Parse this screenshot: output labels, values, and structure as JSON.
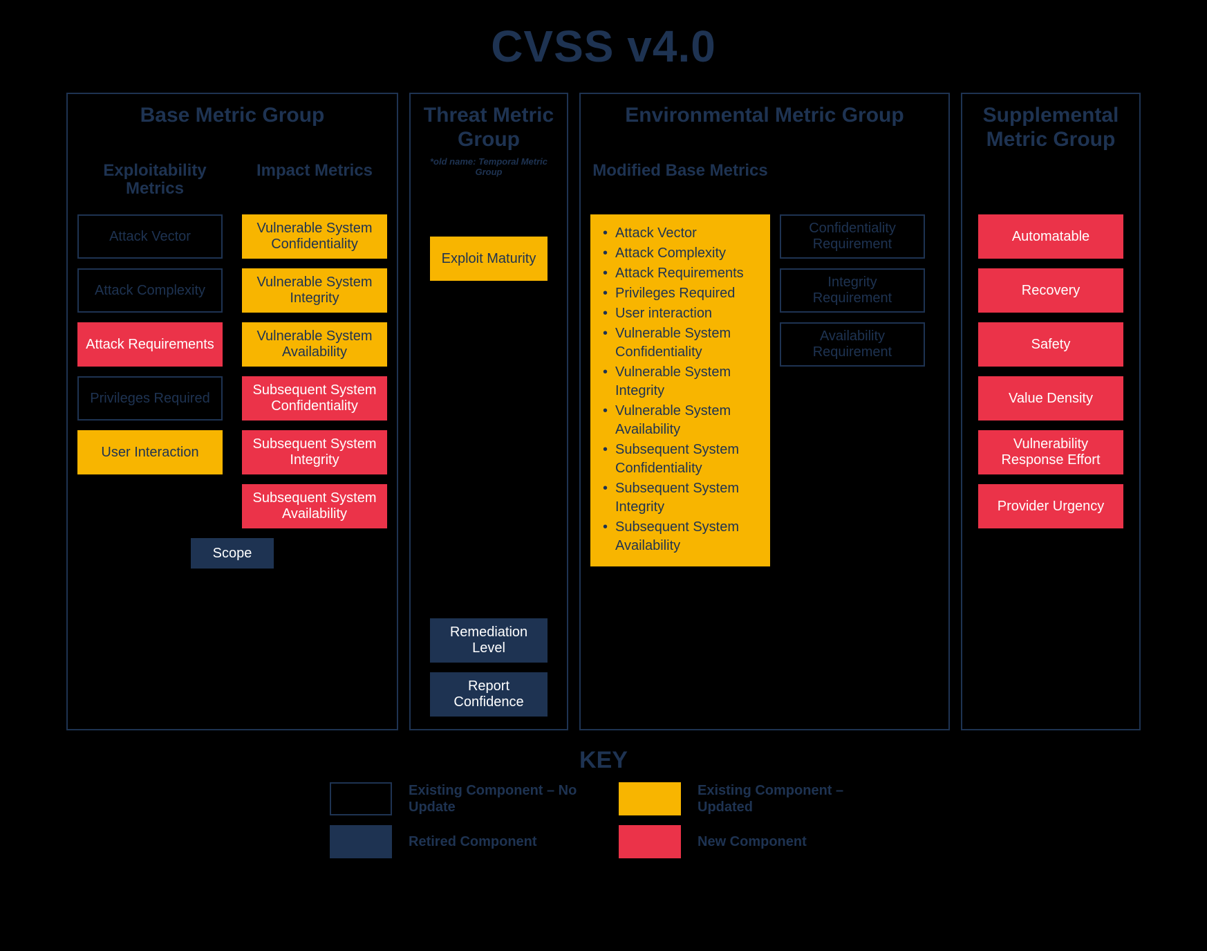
{
  "title": "CVSS v4.0",
  "groups": {
    "base": {
      "title": "Base Metric Group",
      "exploitability": {
        "title": "Exploitability Metrics",
        "items": [
          {
            "label": "Attack Vector",
            "kind": "existing"
          },
          {
            "label": "Attack Complexity",
            "kind": "existing"
          },
          {
            "label": "Attack Requirements",
            "kind": "new"
          },
          {
            "label": "Privileges Required",
            "kind": "existing"
          },
          {
            "label": "User Interaction",
            "kind": "updated"
          }
        ]
      },
      "impact": {
        "title": "Impact Metrics",
        "items": [
          {
            "label": "Vulnerable System Confidentiality",
            "kind": "updated"
          },
          {
            "label": "Vulnerable System Integrity",
            "kind": "updated"
          },
          {
            "label": "Vulnerable System Availability",
            "kind": "updated"
          },
          {
            "label": "Subsequent System Confidentiality",
            "kind": "new"
          },
          {
            "label": "Subsequent System Integrity",
            "kind": "new"
          },
          {
            "label": "Subsequent System Availability",
            "kind": "new"
          }
        ]
      },
      "scope": {
        "label": "Scope",
        "kind": "retired"
      }
    },
    "threat": {
      "title": "Threat Metric Group",
      "note": "*old name: Temporal Metric Group",
      "items_top": [
        {
          "label": "Exploit Maturity",
          "kind": "updated"
        }
      ],
      "items_bottom": [
        {
          "label": "Remediation Level",
          "kind": "retired"
        },
        {
          "label": "Report Confidence",
          "kind": "retired"
        }
      ]
    },
    "env": {
      "title": "Environmental Metric Group",
      "modified": {
        "title": "Modified Base Metrics",
        "items": [
          "Attack Vector",
          "Attack Complexity",
          "Attack Requirements",
          "Privileges Required",
          "User interaction",
          "Vulnerable System Confidentiality",
          "Vulnerable System Integrity",
          "Vulnerable System Availability",
          " Subsequent System Confidentiality",
          "Subsequent System Integrity",
          "Subsequent System Availability"
        ]
      },
      "requirements": [
        {
          "label": "Confidentiality Requirement",
          "kind": "existing"
        },
        {
          "label": "Integrity Requirement",
          "kind": "existing"
        },
        {
          "label": "Availability Requirement",
          "kind": "existing"
        }
      ]
    },
    "supp": {
      "title": "Supplemental Metric Group",
      "items": [
        {
          "label": "Automatable",
          "kind": "new"
        },
        {
          "label": "Recovery",
          "kind": "new"
        },
        {
          "label": "Safety",
          "kind": "new"
        },
        {
          "label": "Value Density",
          "kind": "new"
        },
        {
          "label": "Vulnerability Response Effort",
          "kind": "new"
        },
        {
          "label": "Provider Urgency",
          "kind": "new"
        }
      ]
    }
  },
  "key": {
    "title": "KEY",
    "entries": [
      {
        "kind": "existing",
        "label": "Existing Component – No Update"
      },
      {
        "kind": "updated",
        "label": "Existing Component – Updated"
      },
      {
        "kind": "retired",
        "label": "Retired Component"
      },
      {
        "kind": "new",
        "label": "New Component"
      }
    ]
  }
}
